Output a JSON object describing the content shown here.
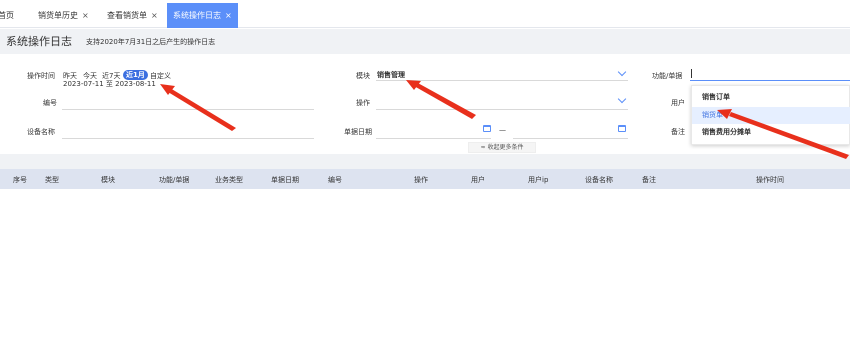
{
  "tabs": [
    {
      "label": "首页",
      "closable": false,
      "active": false
    },
    {
      "label": "销货单历史",
      "closable": true,
      "active": false
    },
    {
      "label": "查看销货单",
      "closable": true,
      "active": false
    },
    {
      "label": "系统操作日志",
      "closable": true,
      "active": true
    }
  ],
  "tab_close_glyph": "×",
  "header": {
    "title": "系统操作日志",
    "subtitle": "支持2020年7月31日之后产生的操作日志"
  },
  "filters": {
    "op_time": {
      "label": "操作时间",
      "options": [
        "昨天",
        "今天",
        "近7天",
        "近1月",
        "自定义"
      ],
      "selected": "近1月",
      "range_text": "2023-07-11 至 2023-08-11"
    },
    "module": {
      "label": "模块",
      "value": "销售管理"
    },
    "function": {
      "label": "功能/单据",
      "value": ""
    },
    "code": {
      "label": "编号",
      "value": ""
    },
    "operation": {
      "label": "操作",
      "value": ""
    },
    "user": {
      "label": "用户",
      "value": ""
    },
    "device": {
      "label": "设备名称",
      "value": ""
    },
    "doc_date": {
      "label": "单据日期",
      "separator": "—",
      "start": "",
      "end": ""
    },
    "remark": {
      "label": "备注",
      "value": ""
    },
    "collapse_label": "收起更多条件",
    "collapse_glyph": "≈"
  },
  "dropdown": {
    "items": [
      "销售订单",
      "销货单",
      "销售费用分摊单"
    ],
    "highlighted": "销货单"
  },
  "table": {
    "columns": [
      "序号",
      "类型",
      "模块",
      "功能/单据",
      "业务类型",
      "单据日期",
      "编号",
      "操作",
      "用户",
      "用户ip",
      "设备名称",
      "备注",
      "操作时间"
    ],
    "rows": []
  },
  "colors": {
    "accent": "#5b8ff9",
    "chip_active": "#3b6fe0",
    "arrow": "#e8301c",
    "table_header_bg": "#dde3f0"
  },
  "icons": [
    "close-icon",
    "chevron-down-icon",
    "calendar-icon",
    "double-chevron-up-icon"
  ]
}
